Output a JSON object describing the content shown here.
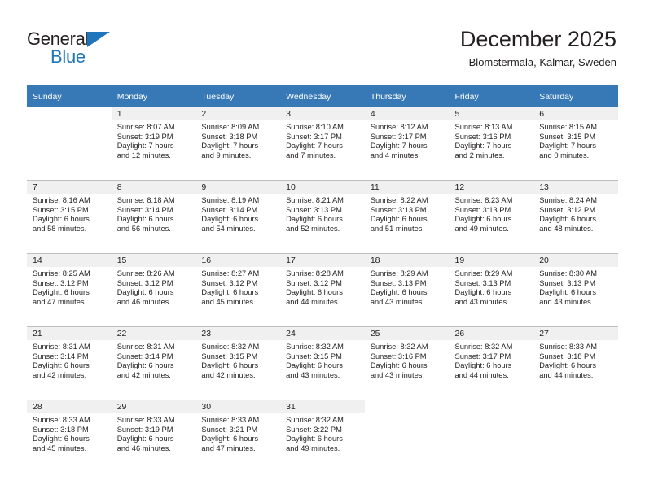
{
  "brand": {
    "name_top": "General",
    "name_bottom": "Blue",
    "accent_color": "#1f76bc"
  },
  "header": {
    "title": "December 2025",
    "subtitle": "Blomstermala, Kalmar, Sweden"
  },
  "theme": {
    "header_row_bg": "#3778b6",
    "day_band_bg": "#f0f0f0",
    "grid_line": "#bfbfbf",
    "text": "#231f20"
  },
  "weekdays": [
    "Sunday",
    "Monday",
    "Tuesday",
    "Wednesday",
    "Thursday",
    "Friday",
    "Saturday"
  ],
  "weeks": [
    [
      {
        "day": "",
        "sunrise": "",
        "sunset": "",
        "daylight_line1": "",
        "daylight_line2": ""
      },
      {
        "day": "1",
        "sunrise": "Sunrise: 8:07 AM",
        "sunset": "Sunset: 3:19 PM",
        "daylight_line1": "Daylight: 7 hours",
        "daylight_line2": "and 12 minutes."
      },
      {
        "day": "2",
        "sunrise": "Sunrise: 8:09 AM",
        "sunset": "Sunset: 3:18 PM",
        "daylight_line1": "Daylight: 7 hours",
        "daylight_line2": "and 9 minutes."
      },
      {
        "day": "3",
        "sunrise": "Sunrise: 8:10 AM",
        "sunset": "Sunset: 3:17 PM",
        "daylight_line1": "Daylight: 7 hours",
        "daylight_line2": "and 7 minutes."
      },
      {
        "day": "4",
        "sunrise": "Sunrise: 8:12 AM",
        "sunset": "Sunset: 3:17 PM",
        "daylight_line1": "Daylight: 7 hours",
        "daylight_line2": "and 4 minutes."
      },
      {
        "day": "5",
        "sunrise": "Sunrise: 8:13 AM",
        "sunset": "Sunset: 3:16 PM",
        "daylight_line1": "Daylight: 7 hours",
        "daylight_line2": "and 2 minutes."
      },
      {
        "day": "6",
        "sunrise": "Sunrise: 8:15 AM",
        "sunset": "Sunset: 3:15 PM",
        "daylight_line1": "Daylight: 7 hours",
        "daylight_line2": "and 0 minutes."
      }
    ],
    [
      {
        "day": "7",
        "sunrise": "Sunrise: 8:16 AM",
        "sunset": "Sunset: 3:15 PM",
        "daylight_line1": "Daylight: 6 hours",
        "daylight_line2": "and 58 minutes."
      },
      {
        "day": "8",
        "sunrise": "Sunrise: 8:18 AM",
        "sunset": "Sunset: 3:14 PM",
        "daylight_line1": "Daylight: 6 hours",
        "daylight_line2": "and 56 minutes."
      },
      {
        "day": "9",
        "sunrise": "Sunrise: 8:19 AM",
        "sunset": "Sunset: 3:14 PM",
        "daylight_line1": "Daylight: 6 hours",
        "daylight_line2": "and 54 minutes."
      },
      {
        "day": "10",
        "sunrise": "Sunrise: 8:21 AM",
        "sunset": "Sunset: 3:13 PM",
        "daylight_line1": "Daylight: 6 hours",
        "daylight_line2": "and 52 minutes."
      },
      {
        "day": "11",
        "sunrise": "Sunrise: 8:22 AM",
        "sunset": "Sunset: 3:13 PM",
        "daylight_line1": "Daylight: 6 hours",
        "daylight_line2": "and 51 minutes."
      },
      {
        "day": "12",
        "sunrise": "Sunrise: 8:23 AM",
        "sunset": "Sunset: 3:13 PM",
        "daylight_line1": "Daylight: 6 hours",
        "daylight_line2": "and 49 minutes."
      },
      {
        "day": "13",
        "sunrise": "Sunrise: 8:24 AM",
        "sunset": "Sunset: 3:12 PM",
        "daylight_line1": "Daylight: 6 hours",
        "daylight_line2": "and 48 minutes."
      }
    ],
    [
      {
        "day": "14",
        "sunrise": "Sunrise: 8:25 AM",
        "sunset": "Sunset: 3:12 PM",
        "daylight_line1": "Daylight: 6 hours",
        "daylight_line2": "and 47 minutes."
      },
      {
        "day": "15",
        "sunrise": "Sunrise: 8:26 AM",
        "sunset": "Sunset: 3:12 PM",
        "daylight_line1": "Daylight: 6 hours",
        "daylight_line2": "and 46 minutes."
      },
      {
        "day": "16",
        "sunrise": "Sunrise: 8:27 AM",
        "sunset": "Sunset: 3:12 PM",
        "daylight_line1": "Daylight: 6 hours",
        "daylight_line2": "and 45 minutes."
      },
      {
        "day": "17",
        "sunrise": "Sunrise: 8:28 AM",
        "sunset": "Sunset: 3:12 PM",
        "daylight_line1": "Daylight: 6 hours",
        "daylight_line2": "and 44 minutes."
      },
      {
        "day": "18",
        "sunrise": "Sunrise: 8:29 AM",
        "sunset": "Sunset: 3:13 PM",
        "daylight_line1": "Daylight: 6 hours",
        "daylight_line2": "and 43 minutes."
      },
      {
        "day": "19",
        "sunrise": "Sunrise: 8:29 AM",
        "sunset": "Sunset: 3:13 PM",
        "daylight_line1": "Daylight: 6 hours",
        "daylight_line2": "and 43 minutes."
      },
      {
        "day": "20",
        "sunrise": "Sunrise: 8:30 AM",
        "sunset": "Sunset: 3:13 PM",
        "daylight_line1": "Daylight: 6 hours",
        "daylight_line2": "and 43 minutes."
      }
    ],
    [
      {
        "day": "21",
        "sunrise": "Sunrise: 8:31 AM",
        "sunset": "Sunset: 3:14 PM",
        "daylight_line1": "Daylight: 6 hours",
        "daylight_line2": "and 42 minutes."
      },
      {
        "day": "22",
        "sunrise": "Sunrise: 8:31 AM",
        "sunset": "Sunset: 3:14 PM",
        "daylight_line1": "Daylight: 6 hours",
        "daylight_line2": "and 42 minutes."
      },
      {
        "day": "23",
        "sunrise": "Sunrise: 8:32 AM",
        "sunset": "Sunset: 3:15 PM",
        "daylight_line1": "Daylight: 6 hours",
        "daylight_line2": "and 42 minutes."
      },
      {
        "day": "24",
        "sunrise": "Sunrise: 8:32 AM",
        "sunset": "Sunset: 3:15 PM",
        "daylight_line1": "Daylight: 6 hours",
        "daylight_line2": "and 43 minutes."
      },
      {
        "day": "25",
        "sunrise": "Sunrise: 8:32 AM",
        "sunset": "Sunset: 3:16 PM",
        "daylight_line1": "Daylight: 6 hours",
        "daylight_line2": "and 43 minutes."
      },
      {
        "day": "26",
        "sunrise": "Sunrise: 8:32 AM",
        "sunset": "Sunset: 3:17 PM",
        "daylight_line1": "Daylight: 6 hours",
        "daylight_line2": "and 44 minutes."
      },
      {
        "day": "27",
        "sunrise": "Sunrise: 8:33 AM",
        "sunset": "Sunset: 3:18 PM",
        "daylight_line1": "Daylight: 6 hours",
        "daylight_line2": "and 44 minutes."
      }
    ],
    [
      {
        "day": "28",
        "sunrise": "Sunrise: 8:33 AM",
        "sunset": "Sunset: 3:18 PM",
        "daylight_line1": "Daylight: 6 hours",
        "daylight_line2": "and 45 minutes."
      },
      {
        "day": "29",
        "sunrise": "Sunrise: 8:33 AM",
        "sunset": "Sunset: 3:19 PM",
        "daylight_line1": "Daylight: 6 hours",
        "daylight_line2": "and 46 minutes."
      },
      {
        "day": "30",
        "sunrise": "Sunrise: 8:33 AM",
        "sunset": "Sunset: 3:21 PM",
        "daylight_line1": "Daylight: 6 hours",
        "daylight_line2": "and 47 minutes."
      },
      {
        "day": "31",
        "sunrise": "Sunrise: 8:32 AM",
        "sunset": "Sunset: 3:22 PM",
        "daylight_line1": "Daylight: 6 hours",
        "daylight_line2": "and 49 minutes."
      },
      {
        "day": "",
        "sunrise": "",
        "sunset": "",
        "daylight_line1": "",
        "daylight_line2": ""
      },
      {
        "day": "",
        "sunrise": "",
        "sunset": "",
        "daylight_line1": "",
        "daylight_line2": ""
      },
      {
        "day": "",
        "sunrise": "",
        "sunset": "",
        "daylight_line1": "",
        "daylight_line2": ""
      }
    ]
  ]
}
